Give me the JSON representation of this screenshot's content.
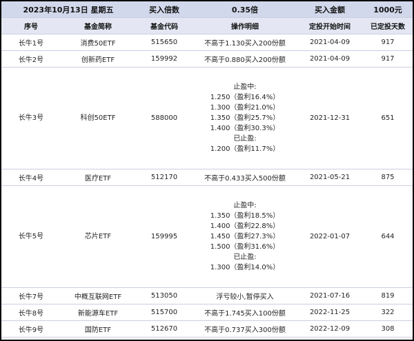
{
  "banner": {
    "date": "2023年10月13日 星期五",
    "multiple_label": "买入倍数",
    "multiple_value": "0.35倍",
    "amount_label": "买入金额",
    "amount_value": "1000元"
  },
  "columns": [
    "序号",
    "基金简称",
    "基金代码",
    "操作明细",
    "定投开始时间",
    "已定投天数"
  ],
  "rows": [
    {
      "id": "长牛1号",
      "name": "消费50ETF",
      "code": "515650",
      "detail": [
        "不高于1.130买入200份额"
      ],
      "start": "2021-04-09",
      "days": "917"
    },
    {
      "id": "长牛2号",
      "name": "创新药ETF",
      "code": "159992",
      "detail": [
        "不高于0.880买入200份额"
      ],
      "start": "2021-04-09",
      "days": "917"
    },
    {
      "id": "长牛3号",
      "name": "科创50ETF",
      "code": "588000",
      "detail": [
        "止盈中:",
        "1.250（盈利16.4%）",
        "1.300（盈利21.0%）",
        "1.350（盈利25.7%）",
        "1.400（盈利30.3%）",
        "已止盈:",
        "1.200（盈利11.7%）"
      ],
      "start": "2021-12-31",
      "days": "651"
    },
    {
      "id": "长牛4号",
      "name": "医疗ETF",
      "code": "512170",
      "detail": [
        "不高于0.433买入500份额"
      ],
      "start": "2021-05-21",
      "days": "875"
    },
    {
      "id": "长牛5号",
      "name": "芯片ETF",
      "code": "159995",
      "detail": [
        "止盈中:",
        "1.350（盈利18.5%）",
        "1.400（盈利22.8%）",
        "1.450（盈利27.3%）",
        "1.500（盈利31.6%）",
        "已止盈:",
        "1.300（盈利14.0%）"
      ],
      "start": "2022-01-07",
      "days": "644"
    },
    {
      "id": "长牛7号",
      "name": "中概互联网ETF",
      "code": "513050",
      "detail": [
        "浮亏较小,暂停买入"
      ],
      "start": "2021-07-16",
      "days": "819"
    },
    {
      "id": "长牛8号",
      "name": "新能源车ETF",
      "code": "515700",
      "detail": [
        "不高于1.745买入100份额"
      ],
      "start": "2022-11-25",
      "days": "322"
    },
    {
      "id": "长牛9号",
      "name": "国防ETF",
      "code": "512670",
      "detail": [
        "不高于0.737买入300份额"
      ],
      "start": "2022-12-09",
      "days": "308"
    }
  ]
}
